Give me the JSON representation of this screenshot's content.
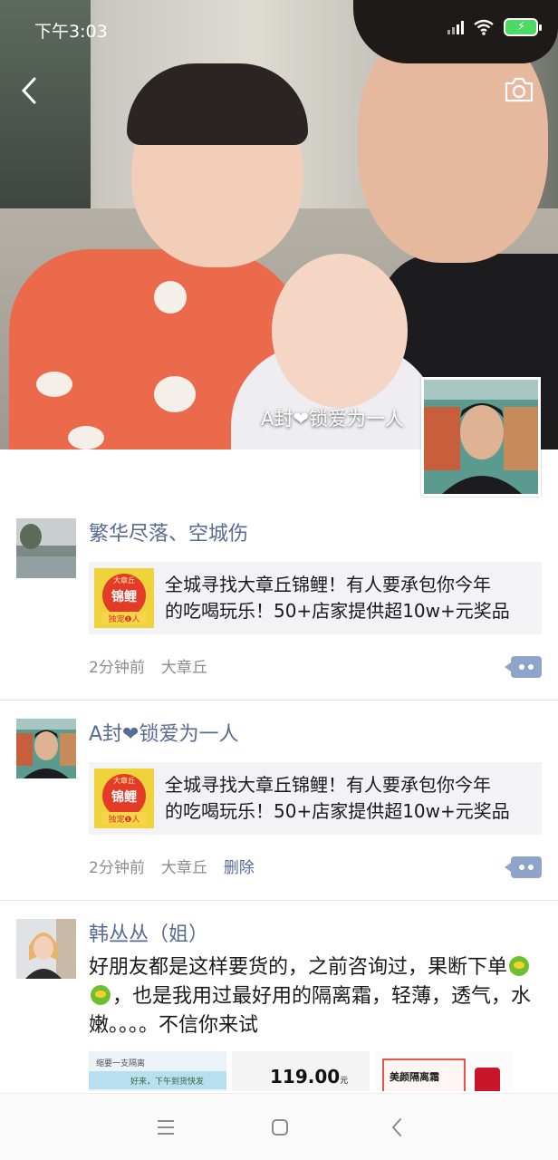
{
  "status_bar": {
    "time": "下午3:03"
  },
  "cover": {
    "owner_name": "A封❤锁爱为一人"
  },
  "posts": [
    {
      "author": "繁华尽落、空城伤",
      "share_text_line1": "全城寻找大章丘锦鲤！有人要承包你今年",
      "share_text_line2": "的吃喝玩乐！50+店家提供超10w+元奖品",
      "share_thumb_top": "大章丘",
      "share_thumb_main": "锦鲤",
      "share_thumb_bottom": "独宠❶人",
      "time": "2分钟前",
      "location": "大章丘"
    },
    {
      "author": "A封❤锁爱为一人",
      "share_text_line1": "全城寻找大章丘锦鲤！有人要承包你今年",
      "share_text_line2": "的吃喝玩乐！50+店家提供超10w+元奖品",
      "share_thumb_top": "大章丘",
      "share_thumb_main": "锦鲤",
      "share_thumb_bottom": "独宠❶人",
      "time": "2分钟前",
      "location": "大章丘",
      "delete_label": "删除"
    },
    {
      "author": "韩丛丛（姐）",
      "text_part1": "好朋友都是这样要货的，之前咨询过，果断下单",
      "text_part2": "，也是我用过最好用的隔离霜，轻薄，透气，水嫩。。。。不信你来试",
      "gallery": [
        {
          "caption": "缩要一支隔离",
          "subcaption": "好来，下午到货快发"
        },
        {
          "caption": "119.00",
          "unit": "元"
        },
        {
          "caption": "美颜隔离霜"
        }
      ]
    }
  ]
}
